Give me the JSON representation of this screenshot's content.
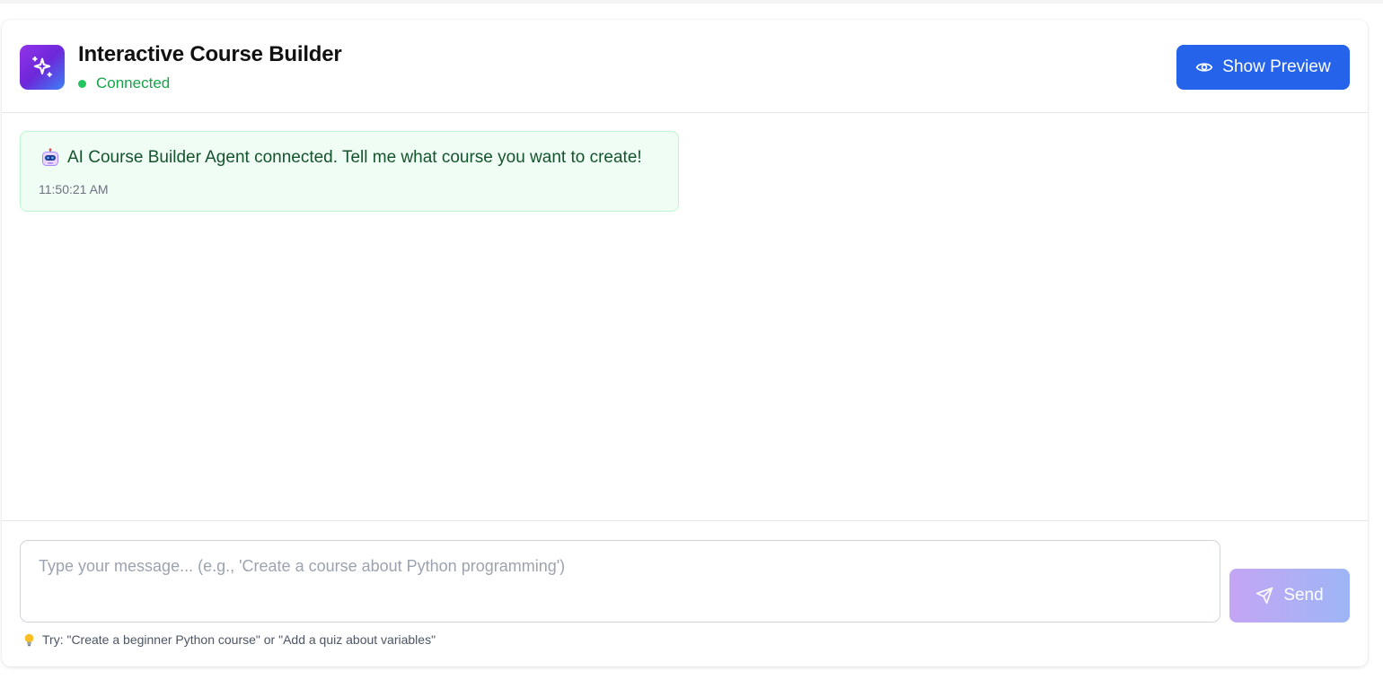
{
  "app": {
    "title": "Interactive Course Builder",
    "status": "Connected",
    "logo_icon": "sparkles-icon"
  },
  "header": {
    "preview_button": {
      "label": "Show Preview",
      "icon": "eye-icon"
    }
  },
  "messages": [
    {
      "icon": "robot-icon",
      "text": "AI Course Builder Agent connected. Tell me what course you want to create!",
      "time": "11:50:21 AM"
    }
  ],
  "composer": {
    "value": "",
    "placeholder": "Type your message... (e.g., 'Create a course about Python programming')",
    "send_label": "Send",
    "send_icon": "send-icon",
    "hint_icon": "lightbulb-icon",
    "hint": "Try: \"Create a beginner Python course\" or \"Add a quiz about variables\""
  },
  "colors": {
    "primary": "#2563eb",
    "status_green": "#22c55e",
    "message_bg": "#f0fdf4",
    "message_border": "#bbf7d0",
    "logo_gradient_start": "#9333ea",
    "logo_gradient_end": "#3b82f6"
  }
}
